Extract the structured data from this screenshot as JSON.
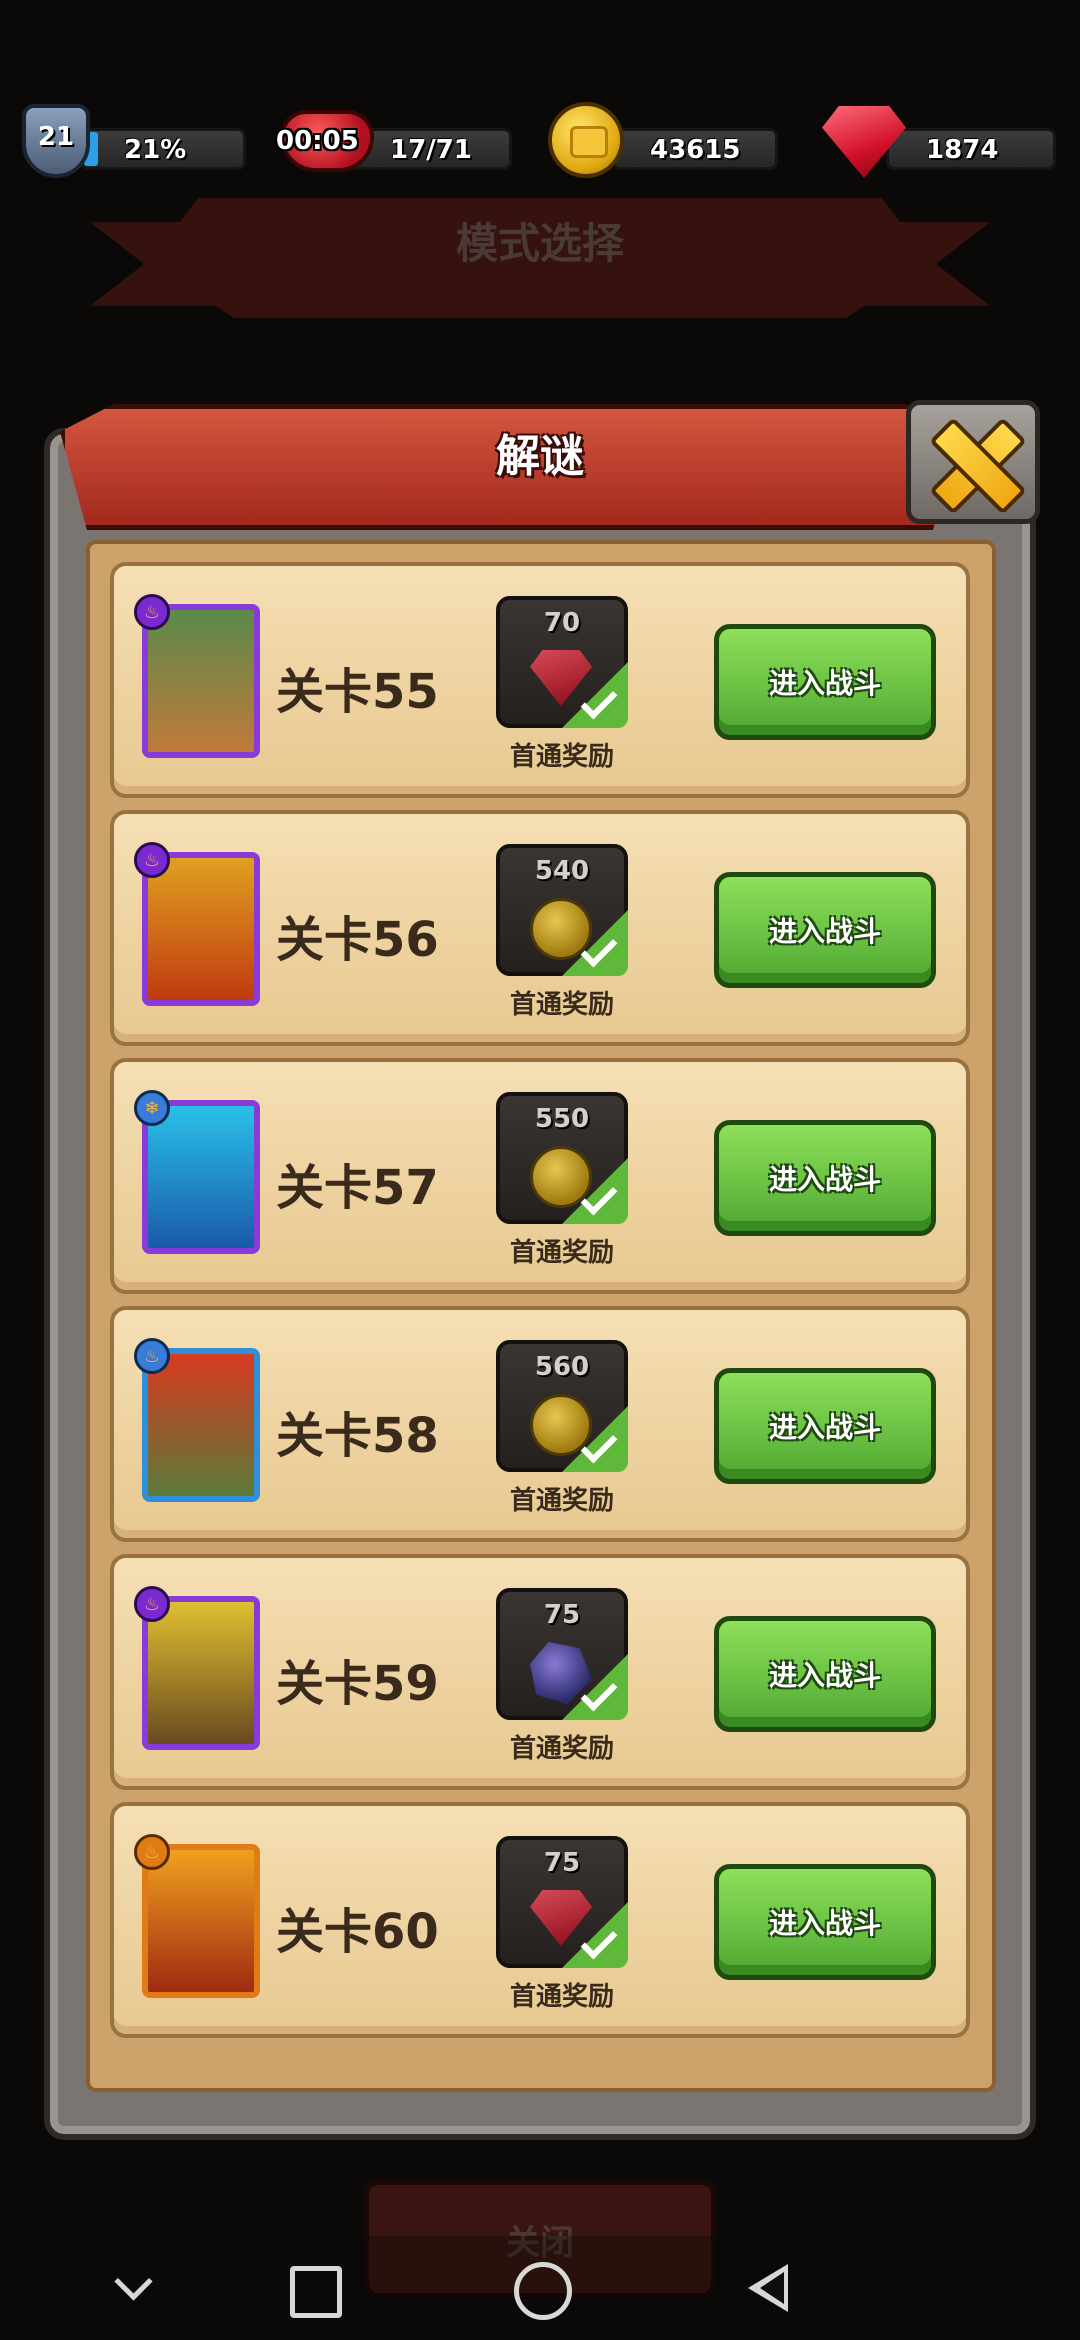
{
  "status_bar": {
    "player_level": "21",
    "xp_percent": "21%",
    "timer": "00:05",
    "hearts": "17/71",
    "gold": "43615",
    "gems": "1874"
  },
  "background": {
    "title": "模式选择"
  },
  "panel": {
    "title": "解谜",
    "levels": [
      {
        "name": "关卡55",
        "reward_amount": "70",
        "reward_icon": "gem-icon",
        "reward_label": "首通奖励",
        "button_label": "进入战斗"
      },
      {
        "name": "关卡56",
        "reward_amount": "540",
        "reward_icon": "coin-icon",
        "reward_label": "首通奖励",
        "button_label": "进入战斗"
      },
      {
        "name": "关卡57",
        "reward_amount": "550",
        "reward_icon": "coin-icon",
        "reward_label": "首通奖励",
        "button_label": "进入战斗"
      },
      {
        "name": "关卡58",
        "reward_amount": "560",
        "reward_icon": "coin-icon",
        "reward_label": "首通奖励",
        "button_label": "进入战斗"
      },
      {
        "name": "关卡59",
        "reward_amount": "75",
        "reward_icon": "crystal-icon",
        "reward_label": "首通奖励",
        "button_label": "进入战斗"
      },
      {
        "name": "关卡60",
        "reward_amount": "75",
        "reward_icon": "gem-icon",
        "reward_label": "首通奖励",
        "button_label": "进入战斗"
      }
    ]
  },
  "bottom": {
    "close_label": "关闭"
  }
}
